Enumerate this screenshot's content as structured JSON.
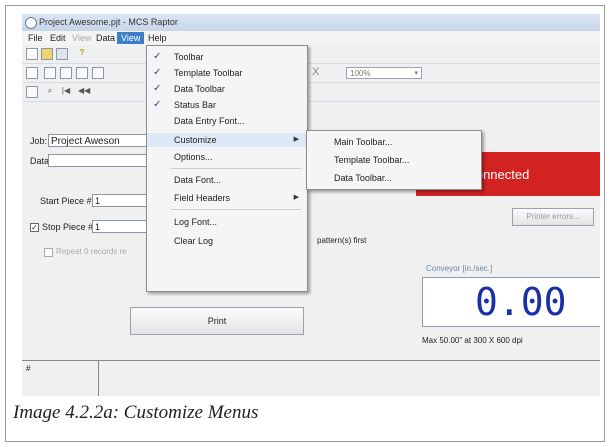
{
  "window": {
    "title": "Project Awesome.pjt - MCS Raptor"
  },
  "menubar": [
    {
      "label": "File",
      "state": "normal"
    },
    {
      "label": "Edit",
      "state": "normal"
    },
    {
      "label": "View",
      "state": "dim"
    },
    {
      "label": "Data",
      "state": "normal"
    },
    {
      "label": "View",
      "state": "active"
    },
    {
      "label": "Help",
      "state": "normal"
    }
  ],
  "toolbar": {
    "zoom": "100%",
    "nav_icons": [
      "|◀",
      "◀◀",
      "▶▶",
      "▶|"
    ]
  },
  "form": {
    "job_label": "Job:",
    "job_value": "Project Aweson",
    "data_label": "Data",
    "start_piece_label": "Start Piece #:",
    "start_piece_value": "1",
    "stop_piece_label": "Stop Piece #:",
    "stop_piece_value": "1",
    "stop_piece_checked": true,
    "repeat_label": "Repeat 0 records re",
    "pattern_text": "pattern(s) first",
    "print_button": "Print",
    "status_banner": "ot Connected",
    "printer_errors_button": "Printer errors...",
    "conveyor_label": "Conveyor [in./sec.]",
    "conveyor_value": "0.00",
    "max_text": "Max 50.00\" at 300 X 600 dpi",
    "grid_header": "#"
  },
  "view_menu": {
    "items": [
      {
        "label": "Toolbar",
        "checked": true
      },
      {
        "label": "Template Toolbar",
        "checked": true
      },
      {
        "label": "Data Toolbar",
        "checked": true
      },
      {
        "label": "Status Bar",
        "checked": true
      },
      {
        "label": "Data Entry Font...",
        "checked": false
      },
      {
        "label": "Customize",
        "checked": false,
        "submenu": true,
        "highlighted": true
      },
      {
        "label": "Options...",
        "checked": false
      },
      {
        "label": "Data Font...",
        "checked": false
      },
      {
        "label": "Field Headers",
        "checked": false,
        "submenu": true
      },
      {
        "label": "Log Font...",
        "checked": false
      },
      {
        "label": "Clear Log",
        "checked": false
      }
    ]
  },
  "customize_submenu": {
    "items": [
      {
        "label": "Main Toolbar..."
      },
      {
        "label": "Template Toolbar..."
      },
      {
        "label": "Data Toolbar..."
      }
    ]
  },
  "caption": "Image 4.2.2a: Customize Menus",
  "colors": {
    "status_red": "#d22222",
    "menu_highlight": "#3c7fc8",
    "digits_blue": "#1a2fa8"
  }
}
